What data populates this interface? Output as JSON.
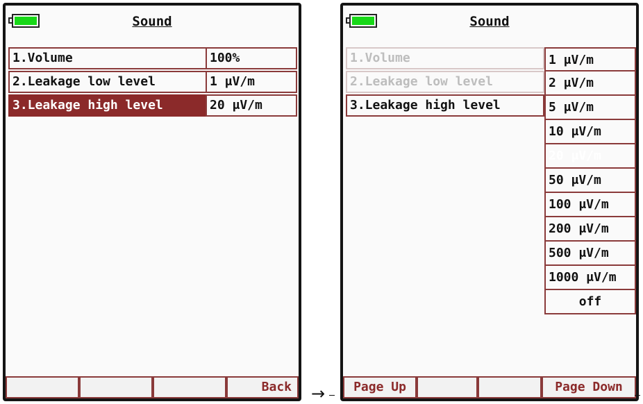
{
  "screen1": {
    "title": "Sound",
    "rows": [
      {
        "label": "1.Volume",
        "value": "100%"
      },
      {
        "label": "2.Leakage low level",
        "value": "1 μV/m"
      },
      {
        "label": "3.Leakage high level",
        "value": "20 μV/m",
        "selected": true
      }
    ],
    "footer": [
      "",
      "",
      "",
      "Back"
    ]
  },
  "arrow": "→",
  "screen2": {
    "title": "Sound",
    "rows": [
      {
        "label": "1.Volume",
        "disabled": true
      },
      {
        "label": "2.Leakage low level",
        "disabled": true
      },
      {
        "label": "3.Leakage high level"
      }
    ],
    "options": [
      "1 μV/m",
      "2 μV/m",
      "5 μV/m",
      "10 μV/m",
      "20 μV/m",
      "50 μV/m",
      "100 μV/m",
      "200 μV/m",
      "500 μV/m",
      "1000 μV/m",
      "off"
    ],
    "selected_option": "20 μV/m",
    "footer": [
      "Page Up",
      "",
      "",
      "Page Down"
    ]
  },
  "colors": {
    "highlight": "#8b2a2a",
    "border": "#8a3a3a",
    "battery": "#18d818",
    "disabled_text": "#bdbdbd"
  },
  "icons": [
    "battery-icon",
    "arrow-right-icon"
  ]
}
